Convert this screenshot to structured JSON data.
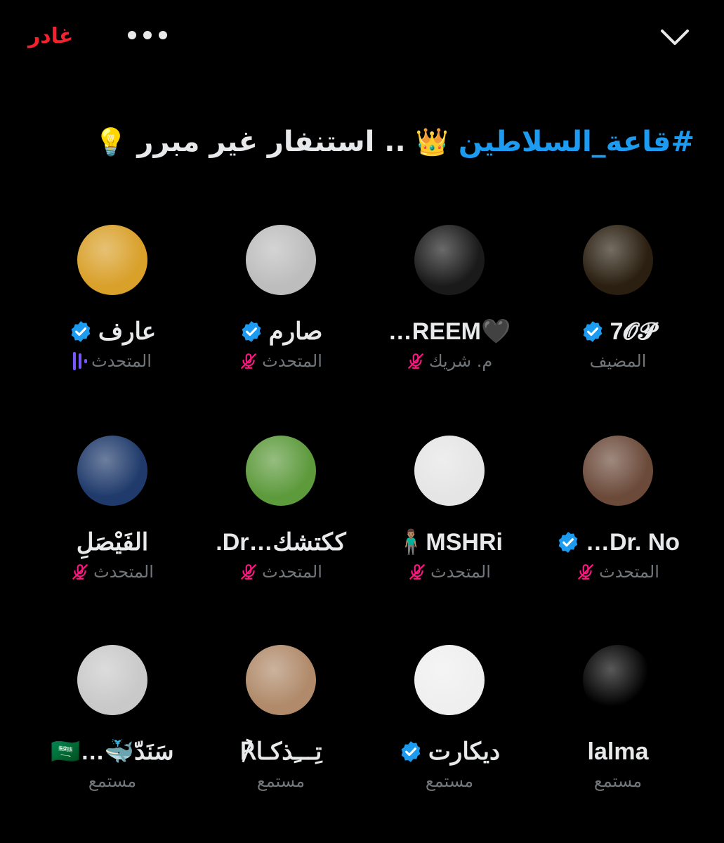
{
  "header": {
    "leave_label": "غادر",
    "more_icon": "more-dots-icon",
    "collapse_icon": "chevron-down-icon"
  },
  "space": {
    "hashtag": "#قاعة_السلاطين",
    "crown": "👑",
    "rest": " .. استنفار غير مبرر ",
    "bulb": "💡"
  },
  "participants": [
    {
      "name": "7𝓞𝓟",
      "verified": true,
      "role": "المضيف",
      "mic": "none",
      "avatar_color": "#2a1f10"
    },
    {
      "name": "🖤REEM…",
      "verified": false,
      "role": "م. شريك",
      "mic": "muted",
      "avatar_color": "#1a1a1a"
    },
    {
      "name": "صارم",
      "verified": true,
      "role": "المتحدث",
      "mic": "muted",
      "avatar_color": "#bdbdbd"
    },
    {
      "name": "عارف",
      "verified": true,
      "role": "المتحدث",
      "mic": "speaking",
      "avatar_color": "#d9a02a"
    },
    {
      "name": "Dr. No…",
      "verified": true,
      "role": "المتحدث",
      "mic": "muted",
      "avatar_color": "#6b4a3a"
    },
    {
      "name": "MSHRi🧍🏽‍♂️",
      "verified": false,
      "role": "المتحدث",
      "mic": "muted",
      "avatar_color": "#e5e5e5"
    },
    {
      "name": "ككتشك…Dr.",
      "verified": false,
      "role": "المتحدث",
      "mic": "muted",
      "avatar_color": "#5d9a3c"
    },
    {
      "name": "الفَيْصَلِ",
      "verified": false,
      "role": "المتحدث",
      "mic": "muted",
      "avatar_color": "#1f3a6b"
    },
    {
      "name": "lalma",
      "verified": false,
      "role": "مستمع",
      "mic": "none",
      "avatar_color": "#000000"
    },
    {
      "name": "ديكارت",
      "verified": true,
      "role": "مستمع",
      "mic": "none",
      "avatar_color": "#efefef"
    },
    {
      "name": "تِـــِذكـا℟",
      "verified": false,
      "role": "مستمع",
      "mic": "none",
      "avatar_color": "#b08a6a"
    },
    {
      "name": "سَنَدّ🐳…🇸🇦",
      "verified": false,
      "role": "مستمع",
      "mic": "none",
      "avatar_color": "#c9c9c9"
    }
  ],
  "colors": {
    "accent": "#1d9bf0",
    "danger": "#f4212e",
    "muted_mic": "#f91880",
    "speaking": "#7856ff",
    "secondary_text": "#71767b"
  }
}
